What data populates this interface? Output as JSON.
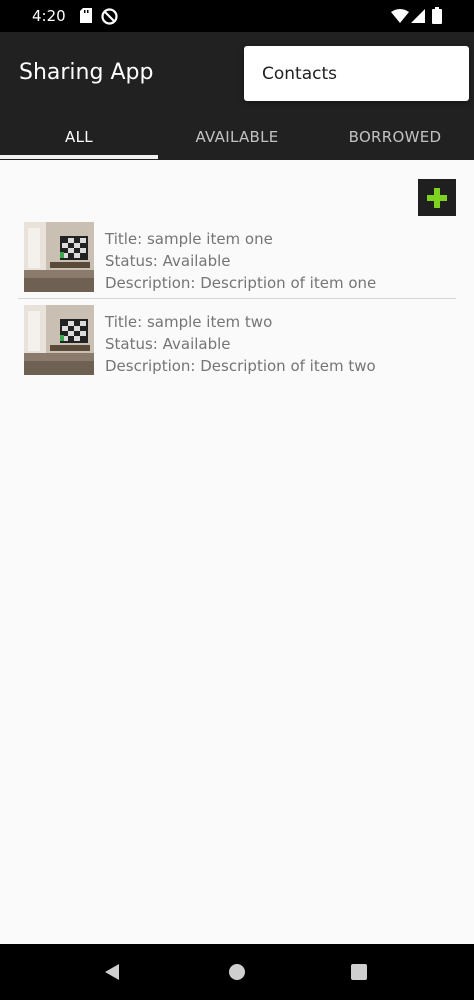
{
  "status_bar": {
    "time": "4:20",
    "icons": [
      "sd-card-icon",
      "do-not-disturb-icon",
      "wifi-icon",
      "cell-signal-icon",
      "battery-icon"
    ]
  },
  "app_bar": {
    "title": "Sharing App",
    "tabs": [
      {
        "label": "ALL",
        "active": true
      },
      {
        "label": "AVAILABLE",
        "active": false
      },
      {
        "label": "BORROWED",
        "active": false
      }
    ]
  },
  "menu": {
    "items": [
      {
        "label": "Contacts"
      }
    ]
  },
  "add_button": {
    "icon": "plus-icon",
    "color": "#7ed321"
  },
  "items": [
    {
      "title": "Title: sample item one",
      "status": "Status: Available",
      "description": "Description: Description of item one",
      "thumbnail": "room-photo"
    },
    {
      "title": "Title: sample item two",
      "status": "Status: Available",
      "description": "Description: Description of item two",
      "thumbnail": "room-photo"
    }
  ],
  "nav_bar": {
    "icons": [
      "back-icon",
      "home-icon",
      "recents-icon"
    ]
  },
  "colors": {
    "app_bar": "#212121",
    "background": "#fafafa",
    "item_text": "#757575"
  }
}
